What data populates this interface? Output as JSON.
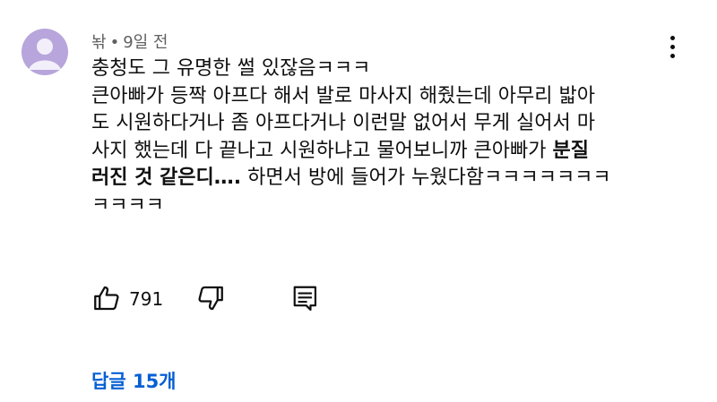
{
  "comment": {
    "author": "놖",
    "separator": "•",
    "time": "9일 전",
    "lines": [
      "충청도 그 유명한 썰 있잖음ㅋㅋㅋ",
      "큰아빠가 등짝 아프다 해서 발로 마사지 해줬는데 아무리 밟아",
      "도 시원하다거나 좀 아프다거나 이런말 없어서 무게 실어서 마",
      "사지 했는데 다 끝나고 시원하냐고 물어보니까 큰아빠가 "
    ],
    "bold_1": "분질",
    "bold_2": "러진 것 같은디….",
    "line5_rest": " 하면서 방에 들어가 누웠다함ㅋㅋㅋㅋㅋㅋㅋ",
    "line6": "ㅋㅋㅋㅋ",
    "like_count": "791",
    "replies_label": "답글 15개"
  },
  "icons": {
    "avatar": "avatar-icon",
    "more": "more-vert-icon",
    "like": "thumb-up-icon",
    "dislike": "thumb-down-icon",
    "reply": "reply-comment-icon"
  },
  "colors": {
    "avatar_bg": "#b7a5db",
    "avatar_fg": "#f3effa",
    "link": "#065fd4",
    "meta": "#606060",
    "text": "#0f0f0f"
  }
}
